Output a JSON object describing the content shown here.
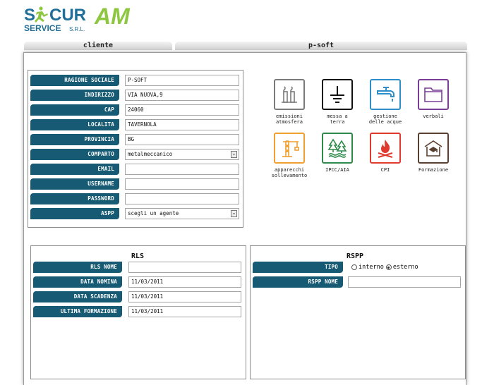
{
  "logo": {
    "brand_part1": "SICUR",
    "brand_part2": "AM",
    "tagline": "SERVICE",
    "suffix": "S.R.L."
  },
  "tabs": [
    {
      "label": "cliente"
    },
    {
      "label": "p-soft"
    }
  ],
  "company": {
    "fields": [
      {
        "label": "RAGIONE SOCIALE",
        "value": "P-SOFT"
      },
      {
        "label": "INDIRIZZO",
        "value": "VIA NUOVA,9"
      },
      {
        "label": "CAP",
        "value": "24060"
      },
      {
        "label": "LOCALITA",
        "value": "TAVERNOLA"
      },
      {
        "label": "PROVINCIA",
        "value": "BG"
      },
      {
        "label": "COMPARTO",
        "value": "metalmeccanico"
      },
      {
        "label": "EMAIL",
        "value": ""
      },
      {
        "label": "USERNAME",
        "value": ""
      },
      {
        "label": "PASSWORD",
        "value": ""
      },
      {
        "label": "ASPP",
        "value": "scegli un agente"
      }
    ]
  },
  "modules": [
    {
      "label": "emissioni\natmosfera",
      "color": "#7a7a7a",
      "icon": "chimneys-icon"
    },
    {
      "label": "messa a\nterra",
      "color": "#111111",
      "icon": "ground-icon"
    },
    {
      "label": "gestione\ndelle acque",
      "color": "#2e8ec9",
      "icon": "faucet-icon"
    },
    {
      "label": "verbali",
      "color": "#7a3e98",
      "icon": "folder-icon"
    },
    {
      "label": "apparecchi\nsollevamento",
      "color": "#f0a030",
      "icon": "crane-icon"
    },
    {
      "label": "IPCC/AIA",
      "color": "#2e8a4a",
      "icon": "forest-icon"
    },
    {
      "label": "CPI",
      "color": "#e03a2e",
      "icon": "fire-icon"
    },
    {
      "label": "Formazione",
      "color": "#5a4030",
      "icon": "school-icon"
    }
  ],
  "rls": {
    "title": "RLS",
    "fields": [
      {
        "label": "RLS NOME",
        "value": ""
      },
      {
        "label": "DATA NOMINA",
        "value": "11/03/2011"
      },
      {
        "label": "DATA SCADENZA",
        "value": "11/03/2011"
      },
      {
        "label": "ULTIMA FORMAZIONE",
        "value": "11/03/2011"
      }
    ]
  },
  "rspp": {
    "title": "RSPP",
    "tipo_label": "TIPO",
    "option_interno": "interno",
    "option_esterno": "esterno",
    "selected": "esterno",
    "nome_label": "RSPP NOME",
    "nome_value": ""
  },
  "colors": {
    "label_bg": "#175a74",
    "brand_blue": "#1f6f98",
    "brand_green": "#8dc63f"
  }
}
